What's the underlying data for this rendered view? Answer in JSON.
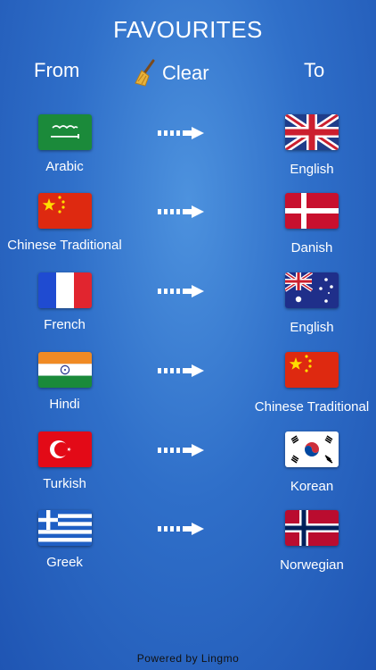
{
  "header": {
    "title": "FAVOURITES",
    "from_label": "From",
    "clear_label": "Clear",
    "to_label": "To"
  },
  "favourites": [
    {
      "from": {
        "name": "Arabic",
        "flag": "saudi-arabia"
      },
      "to": {
        "name": "English",
        "flag": "united-kingdom"
      }
    },
    {
      "from": {
        "name": "Chinese Traditional",
        "flag": "china"
      },
      "to": {
        "name": "Danish",
        "flag": "denmark"
      }
    },
    {
      "from": {
        "name": "French",
        "flag": "france"
      },
      "to": {
        "name": "English",
        "flag": "australia"
      }
    },
    {
      "from": {
        "name": "Hindi",
        "flag": "india"
      },
      "to": {
        "name": "Chinese Traditional",
        "flag": "china"
      }
    },
    {
      "from": {
        "name": "Turkish",
        "flag": "turkey"
      },
      "to": {
        "name": "Korean",
        "flag": "south-korea"
      }
    },
    {
      "from": {
        "name": "Greek",
        "flag": "greece"
      },
      "to": {
        "name": "Norwegian",
        "flag": "norway"
      }
    }
  ],
  "footer": {
    "text": "Powered by Lingmo"
  },
  "icons": {
    "clear": "broom-icon",
    "direction": "dashed-arrow-right-icon"
  },
  "colors": {
    "background": "#2f6fc9",
    "text": "#ffffff",
    "footer_text": "#111111"
  }
}
